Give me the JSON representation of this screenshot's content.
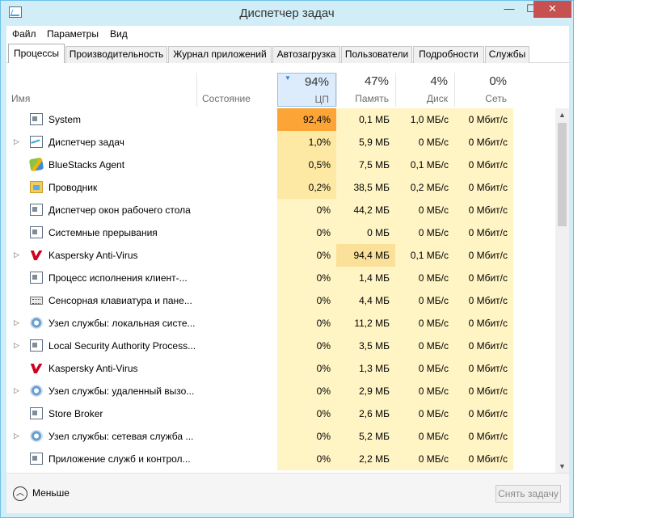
{
  "window": {
    "title": "Диспетчер задач"
  },
  "menu": [
    "Файл",
    "Параметры",
    "Вид"
  ],
  "tabs": [
    "Процессы",
    "Производительность",
    "Журнал приложений",
    "Автозагрузка",
    "Пользователи",
    "Подробности",
    "Службы"
  ],
  "columns": {
    "name": "Имя",
    "status": "Состояние",
    "cpu": {
      "percent": "94%",
      "label": "ЦП"
    },
    "memory": {
      "percent": "47%",
      "label": "Память"
    },
    "disk": {
      "percent": "4%",
      "label": "Диск"
    },
    "network": {
      "percent": "0%",
      "label": "Сеть"
    }
  },
  "rows": [
    {
      "name": "System",
      "icon": "system-icon",
      "expandable": false,
      "cpu": "92,4%",
      "mem": "0,1 МБ",
      "disk": "1,0 МБ/с",
      "net": "0 Мбит/с"
    },
    {
      "name": "Диспетчер задач",
      "icon": "task-manager-icon",
      "expandable": true,
      "cpu": "1,0%",
      "mem": "5,9 МБ",
      "disk": "0 МБ/с",
      "net": "0 Мбит/с"
    },
    {
      "name": "BlueStacks Agent",
      "icon": "bluestacks-icon",
      "expandable": false,
      "cpu": "0,5%",
      "mem": "7,5 МБ",
      "disk": "0,1 МБ/с",
      "net": "0 Мбит/с"
    },
    {
      "name": "Проводник",
      "icon": "explorer-icon",
      "expandable": false,
      "cpu": "0,2%",
      "mem": "38,5 МБ",
      "disk": "0,2 МБ/с",
      "net": "0 Мбит/с"
    },
    {
      "name": "Диспетчер окон рабочего стола",
      "icon": "system-icon",
      "expandable": false,
      "cpu": "0%",
      "mem": "44,2 МБ",
      "disk": "0 МБ/с",
      "net": "0 Мбит/с"
    },
    {
      "name": "Системные прерывания",
      "icon": "system-icon",
      "expandable": false,
      "cpu": "0%",
      "mem": "0 МБ",
      "disk": "0 МБ/с",
      "net": "0 Мбит/с"
    },
    {
      "name": "Kaspersky Anti-Virus",
      "icon": "kaspersky-icon",
      "expandable": true,
      "cpu": "0%",
      "mem": "94,4 МБ",
      "disk": "0,1 МБ/с",
      "net": "0 Мбит/с"
    },
    {
      "name": "Процесс исполнения клиент-...",
      "icon": "system-icon",
      "expandable": false,
      "cpu": "0%",
      "mem": "1,4 МБ",
      "disk": "0 МБ/с",
      "net": "0 Мбит/с"
    },
    {
      "name": "Сенсорная клавиатура и пане...",
      "icon": "keyboard-icon",
      "expandable": false,
      "cpu": "0%",
      "mem": "4,4 МБ",
      "disk": "0 МБ/с",
      "net": "0 Мбит/с"
    },
    {
      "name": "Узел службы: локальная систе...",
      "icon": "gear-icon",
      "expandable": true,
      "cpu": "0%",
      "mem": "11,2 МБ",
      "disk": "0 МБ/с",
      "net": "0 Мбит/с"
    },
    {
      "name": "Local Security Authority Process...",
      "icon": "system-icon",
      "expandable": true,
      "cpu": "0%",
      "mem": "3,5 МБ",
      "disk": "0 МБ/с",
      "net": "0 Мбит/с"
    },
    {
      "name": "Kaspersky Anti-Virus",
      "icon": "kaspersky-icon",
      "expandable": false,
      "cpu": "0%",
      "mem": "1,3 МБ",
      "disk": "0 МБ/с",
      "net": "0 Мбит/с"
    },
    {
      "name": "Узел службы: удаленный вызо...",
      "icon": "gear-icon",
      "expandable": true,
      "cpu": "0%",
      "mem": "2,9 МБ",
      "disk": "0 МБ/с",
      "net": "0 Мбит/с"
    },
    {
      "name": "Store Broker",
      "icon": "system-icon",
      "expandable": false,
      "cpu": "0%",
      "mem": "2,6 МБ",
      "disk": "0 МБ/с",
      "net": "0 Мбит/с"
    },
    {
      "name": "Узел службы: сетевая служба ...",
      "icon": "gear-icon",
      "expandable": true,
      "cpu": "0%",
      "mem": "5,2 МБ",
      "disk": "0 МБ/с",
      "net": "0 Мбит/с"
    },
    {
      "name": "Приложение служб и контрол...",
      "icon": "system-icon",
      "expandable": false,
      "cpu": "0%",
      "mem": "2,2 МБ",
      "disk": "0 МБ/с",
      "net": "0 Мбит/с"
    }
  ],
  "footer": {
    "fewer_label": "Меньше",
    "end_task_label": "Снять задачу"
  },
  "colors": {
    "cpu_hot": "#fca435",
    "heat_light": "#fff4c4",
    "heat_mid": "#fde9a3",
    "close_button": "#c75050"
  }
}
